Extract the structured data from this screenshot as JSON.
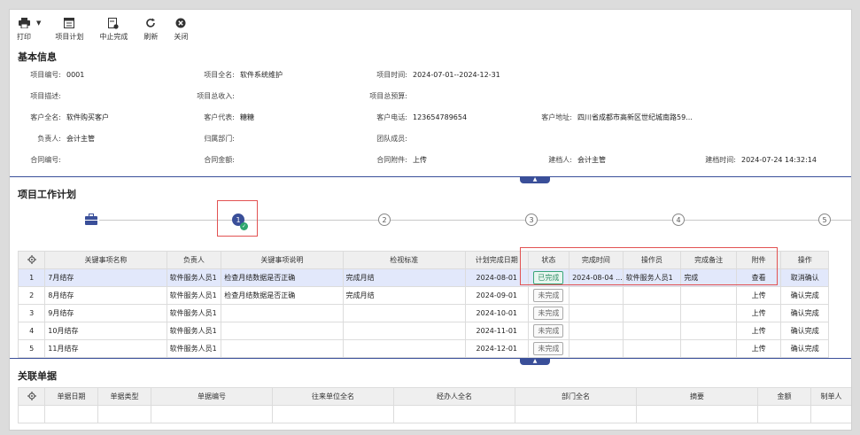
{
  "toolbar": {
    "print": "打印",
    "plan": "项目计划",
    "stop": "中止完成",
    "refresh": "刷新",
    "close": "关闭"
  },
  "basic": {
    "title": "基本信息",
    "project_no_label": "项目编号:",
    "project_no": "0001",
    "project_name_label": "项目全名:",
    "project_name": "软件系统维护",
    "project_time_label": "项目时间:",
    "project_time": "2024-07-01--2024-12-31",
    "project_desc_label": "项目描述:",
    "income_label": "项目总收入:",
    "budget_label": "项目总预算:",
    "customer_label": "客户全名:",
    "customer": "软件购买客户",
    "rep_label": "客户代表:",
    "rep": "糖糖",
    "phone_label": "客户电话:",
    "phone": "123654789654",
    "address_label": "客户地址:",
    "address": "四川省成都市高新区世纪城南路59...",
    "owner_label": "负责人:",
    "owner": "会计主管",
    "dept_label": "归属部门:",
    "team_label": "团队成员:",
    "contract_no_label": "合同编号:",
    "contract_amt_label": "合同金额:",
    "contract_file_label": "合同附件:",
    "contract_file": "上传",
    "creator_label": "建档人:",
    "creator": "会计主管",
    "created_label": "建档时间:",
    "created": "2024-07-24 14:32:14"
  },
  "plan": {
    "title": "项目工作计划",
    "steps": [
      "1",
      "2",
      "3",
      "4",
      "5"
    ],
    "columns": [
      "关键事项名称",
      "负责人",
      "关键事项说明",
      "检视标准",
      "计划完成日期",
      "状态",
      "完成时间",
      "操作员",
      "完成备注",
      "附件",
      "操作"
    ],
    "rows": [
      {
        "no": "1",
        "name": "7月结存",
        "owner": "软件服务人员1",
        "desc": "检查月结数据是否正确",
        "std": "完成月结",
        "date": "2024-08-01",
        "status": "已完成",
        "done_time": "2024-08-04 ...",
        "operator": "软件服务人员1",
        "note": "完成",
        "attach": "查看",
        "action": "取消确认"
      },
      {
        "no": "2",
        "name": "8月结存",
        "owner": "软件服务人员1",
        "desc": "检查月结数据是否正确",
        "std": "完成月结",
        "date": "2024-09-01",
        "status": "未完成",
        "done_time": "",
        "operator": "",
        "note": "",
        "attach": "上传",
        "action": "确认完成"
      },
      {
        "no": "3",
        "name": "9月结存",
        "owner": "软件服务人员1",
        "desc": "",
        "std": "",
        "date": "2024-10-01",
        "status": "未完成",
        "done_time": "",
        "operator": "",
        "note": "",
        "attach": "上传",
        "action": "确认完成"
      },
      {
        "no": "4",
        "name": "10月结存",
        "owner": "软件服务人员1",
        "desc": "",
        "std": "",
        "date": "2024-11-01",
        "status": "未完成",
        "done_time": "",
        "operator": "",
        "note": "",
        "attach": "上传",
        "action": "确认完成"
      },
      {
        "no": "5",
        "name": "11月结存",
        "owner": "软件服务人员1",
        "desc": "",
        "std": "",
        "date": "2024-12-01",
        "status": "未完成",
        "done_time": "",
        "operator": "",
        "note": "",
        "attach": "上传",
        "action": "确认完成"
      }
    ]
  },
  "related": {
    "title": "关联单据",
    "columns": [
      "单据日期",
      "单据类型",
      "单据编号",
      "往来单位全名",
      "经办人全名",
      "部门全名",
      "摘要",
      "金额",
      "制单人"
    ]
  },
  "colors": {
    "accent": "#3a4f99",
    "link": "#2c4fd6",
    "highlight": "#e25252",
    "done": "#2f8f67"
  }
}
